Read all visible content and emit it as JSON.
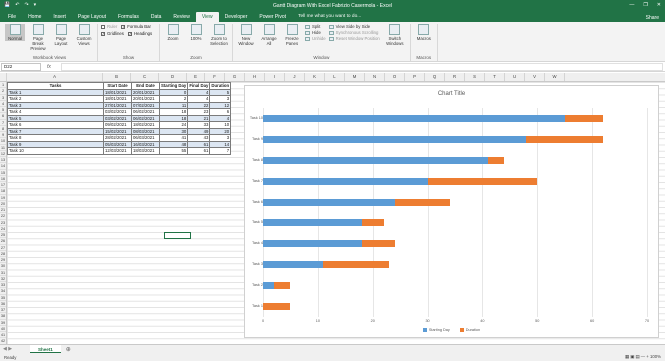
{
  "window": {
    "title": "Gantt Diagram With Excel Fabrizio Casermola - Excel",
    "controls": [
      "—",
      "❐",
      "✕"
    ],
    "qat": [
      "💾",
      "↶",
      "↷",
      "▾"
    ]
  },
  "tabs": {
    "items": [
      "File",
      "Home",
      "Insert",
      "Page Layout",
      "Formulas",
      "Data",
      "Review",
      "View",
      "Developer",
      "Power Pivot"
    ],
    "active": "View",
    "tell": "Tell me what you want to do...",
    "share": "Share"
  },
  "ribbon": {
    "workbook_views": {
      "name": "Workbook Views",
      "normal": "Normal",
      "page_break": "Page Break Preview",
      "page_layout": "Page Layout",
      "custom": "Custom Views"
    },
    "show": {
      "name": "Show",
      "ruler": "Ruler",
      "gridlines": "Gridlines",
      "formula_bar": "Formula Bar",
      "headings": "Headings"
    },
    "zoom": {
      "name": "Zoom",
      "zoom": "Zoom",
      "hundred": "100%",
      "selection": "Zoom to Selection"
    },
    "window": {
      "name": "Window",
      "new_window": "New Window",
      "arrange_all": "Arrange All",
      "freeze": "Freeze Panes",
      "split": "Split",
      "hide": "Hide",
      "unhide": "Unhide",
      "side_by_side": "View Side by Side",
      "sync_scroll": "Synchronous Scrolling",
      "reset_pos": "Reset Window Position",
      "switch": "Switch Windows"
    },
    "macros": {
      "name": "Macros",
      "macros": "Macros"
    }
  },
  "formula": {
    "namebox": "D22",
    "fx": "fx",
    "value": ""
  },
  "columns": [
    "A",
    "B",
    "C",
    "D",
    "E",
    "F",
    "G",
    "H",
    "I",
    "J",
    "K",
    "L",
    "M",
    "N",
    "O",
    "P",
    "Q",
    "R",
    "S",
    "T",
    "U",
    "V",
    "W"
  ],
  "table": {
    "headers": [
      "Tasks",
      "Start Date",
      "End Date",
      "Starting Day",
      "Final Day",
      "Duration"
    ],
    "rows": [
      [
        "Task 1",
        "18/01/2021",
        "20/01/2021",
        "0",
        "4",
        "5"
      ],
      [
        "Task 2",
        "18/01/2021",
        "20/01/2021",
        "2",
        "4",
        "3"
      ],
      [
        "Task 3",
        "27/01/2021",
        "07/02/2021",
        "11",
        "22",
        "12"
      ],
      [
        "Task 4",
        "03/02/2021",
        "06/02/2021",
        "18",
        "23",
        "6"
      ],
      [
        "Task 5",
        "03/02/2021",
        "06/02/2021",
        "18",
        "21",
        "4"
      ],
      [
        "Task 6",
        "09/02/2021",
        "18/02/2021",
        "24",
        "33",
        "10"
      ],
      [
        "Task 7",
        "15/02/2021",
        "08/03/2021",
        "30",
        "49",
        "20"
      ],
      [
        "Task 8",
        "28/02/2021",
        "06/03/2021",
        "41",
        "43",
        "3"
      ],
      [
        "Task 9",
        "05/03/2021",
        "16/03/2021",
        "48",
        "61",
        "14"
      ],
      [
        "Task 10",
        "12/03/2021",
        "18/03/2021",
        "55",
        "61",
        "7"
      ]
    ]
  },
  "chart_data": {
    "type": "bar",
    "title": "Chart Title",
    "orientation": "horizontal-stacked",
    "categories": [
      "Task 10",
      "Task 9",
      "Task 8",
      "Task 7",
      "Task 6",
      "Task 5",
      "Task 4",
      "Task 3",
      "Task 2",
      "Task 1"
    ],
    "series": [
      {
        "name": "Starting Day",
        "color": "#5b9bd5",
        "values": [
          55,
          48,
          41,
          30,
          24,
          18,
          18,
          11,
          2,
          0
        ]
      },
      {
        "name": "Duration",
        "color": "#ed7d31",
        "values": [
          7,
          14,
          3,
          20,
          10,
          4,
          6,
          12,
          3,
          5
        ]
      }
    ],
    "xlim": [
      0,
      70
    ],
    "xticks": [
      "0",
      "10",
      "20",
      "30",
      "40",
      "50",
      "60",
      "70"
    ]
  },
  "sheet": {
    "tab": "Sheet1",
    "add": "⊕"
  },
  "status": {
    "left": "Ready",
    "right": "▦  ▣  ▤  —  +  100%"
  }
}
